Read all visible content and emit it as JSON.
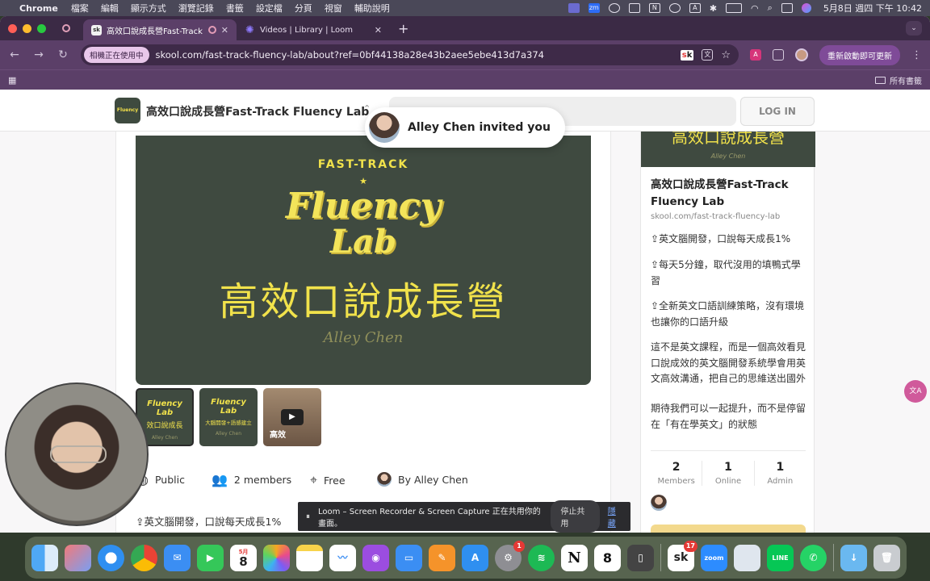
{
  "menubar": {
    "app": "Chrome",
    "menus": [
      "檔案",
      "編輯",
      "顯示方式",
      "瀏覽記錄",
      "書籤",
      "設定檔",
      "分頁",
      "視窗",
      "輔助說明"
    ],
    "status_zm": "zm",
    "status_n": "N",
    "status_a": "A",
    "clock": "5月8日 週四 下午 10:42"
  },
  "tabs": [
    {
      "title": "高效口說成長營Fast-Track",
      "favicon": "sk",
      "active": true
    },
    {
      "title": "Videos | Library | Loom",
      "favicon": "loom",
      "active": false
    }
  ],
  "toolbar": {
    "camera_pill": "相機正在使用中",
    "url": "skool.com/fast-track-fluency-lab/about?ref=0bf44138a28e43b2aee5ebe413d7a374",
    "update_button": "重新啟動即可更新"
  },
  "bookmarks": {
    "all_bookmarks": "所有書籤"
  },
  "site": {
    "logo_text": "Fluency Lab",
    "name": "高效口說成長營Fast-Track Fluency Lab",
    "login": "LOG IN"
  },
  "invite": {
    "text": "Alley Chen invited you"
  },
  "hero": {
    "fast_track": "FAST-TRACK",
    "fluency": "Fluency",
    "lab": "Lab",
    "chinese": "高效口說成長營",
    "signature": "Alley Chen"
  },
  "thumbnails": [
    {
      "line1": "Fluency",
      "line2": "Lab",
      "line3": "效口說成長",
      "line4": "Alley Chen"
    },
    {
      "line1": "Fluency",
      "line2": "Lab",
      "line3": "大腦開發+語感建立",
      "line4": "Alley Chen"
    },
    {
      "video_text": "高效"
    }
  ],
  "meta": {
    "public": "Public",
    "members": "2 members",
    "price": "Free",
    "by": "By Alley Chen"
  },
  "description_first": "英文腦開發，口說每天成長1%",
  "side": {
    "image_text": "高效口說成長營",
    "image_sig": "Alley Chen",
    "title": "高效口說成長營Fast-Track Fluency Lab",
    "url": "skool.com/fast-track-fluency-lab",
    "p1": "英文腦開發，口說每天成長1%",
    "p2": "每天5分鐘，取代沒用的填鴨式學習",
    "p3": "全新英文口語訓練策略，沒有環境也讓你的口語升級",
    "p4": "這不是英文課程，而是一個高效看見口說成效的英文腦開發系統學會用英文高效溝通，把自己的思維送出國外",
    "p5": "期待我們可以一起提升，而不是停留在「有在學英文」的狀態",
    "stats": [
      {
        "value": "2",
        "label": "Members"
      },
      {
        "value": "1",
        "label": "Online"
      },
      {
        "value": "1",
        "label": "Admin"
      }
    ]
  },
  "loom_bar": {
    "message": "Loom – Screen Recorder & Screen Capture 正在共用你的畫面。",
    "stop": "停止共用",
    "hide": "隱藏"
  },
  "dock": {
    "calendar_month": "5月",
    "calendar_day": "8",
    "app_store_badge": "1",
    "skool_badge": "17",
    "zoom": "zoom",
    "line": "LINE",
    "notion": "N",
    "skool": "sk"
  },
  "colors": {
    "browser_chrome": "#5b3f68",
    "tab_bar": "#3b2a45",
    "hero_bg": "#3f4a40",
    "hero_yellow": "#f1e24b"
  }
}
